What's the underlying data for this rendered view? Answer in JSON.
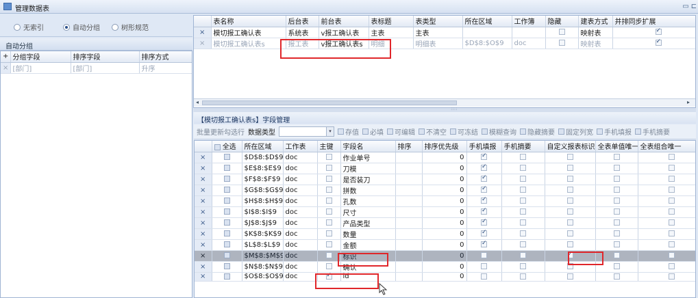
{
  "window": {
    "title": "管理数据表"
  },
  "index_options": [
    {
      "label": "无索引",
      "selected": false
    },
    {
      "label": "自动分组",
      "selected": true
    },
    {
      "label": "树形规范",
      "selected": false
    }
  ],
  "auto_group": {
    "title": "自动分组",
    "columns": [
      "分组字段",
      "排序字段",
      "排序方式"
    ],
    "rows": [
      {
        "group_field": "[部门]",
        "sort_field": "[部门]",
        "sort_order": "升序"
      }
    ]
  },
  "tables_grid": {
    "columns": [
      "表名称",
      "后台表",
      "前台表",
      "表标题",
      "表类型",
      "所在区域",
      "工作簿",
      "隐藏",
      "建表方式",
      "并排同步扩展"
    ],
    "rows": [
      {
        "name": "模切报工确认表",
        "backend": "系统表",
        "frontend": "v报工确认表",
        "title": "主表",
        "type": "主表",
        "region": "",
        "workbook": "",
        "hidden": false,
        "method": "映射表",
        "sync": true
      },
      {
        "name": "模切报工确认表s",
        "backend": "报工表",
        "frontend": "v报工确认表s",
        "title": "明细",
        "type": "明细表",
        "region": "$D$8:$O$9",
        "workbook": "doc",
        "hidden": false,
        "method": "映射表",
        "sync": true
      }
    ]
  },
  "field_section": {
    "title": "【模切报工确认表s】字段管理",
    "toolbar": {
      "batch_label": "批量更新勾选行",
      "datatype_label": "数据类型",
      "checks": [
        "存值",
        "必填",
        "可编辑",
        "不清空",
        "可冻结",
        "模糊查询",
        "隐藏摘要",
        "固定列宽",
        "手机填报",
        "手机摘要"
      ]
    },
    "columns": [
      "全选",
      "所在区域",
      "工作表",
      "主键",
      "字段名",
      "排序",
      "排序优先级",
      "手机填报",
      "手机摘要",
      "自定义报表标识",
      "全表单值唯一",
      "全表组合唯一"
    ],
    "rows": [
      {
        "region": "$D$8:$D$9",
        "sheet": "doc",
        "pk": false,
        "field": "作业单号",
        "priority": "0",
        "mobile": true,
        "custom": false
      },
      {
        "region": "$E$8:$E$9",
        "sheet": "doc",
        "pk": false,
        "field": "刀模",
        "priority": "0",
        "mobile": true,
        "custom": false
      },
      {
        "region": "$F$8:$F$9",
        "sheet": "doc",
        "pk": false,
        "field": "是否装刀",
        "priority": "0",
        "mobile": true,
        "custom": false
      },
      {
        "region": "$G$8:$G$9",
        "sheet": "doc",
        "pk": false,
        "field": "拼数",
        "priority": "0",
        "mobile": true,
        "custom": false
      },
      {
        "region": "$H$8:$H$9",
        "sheet": "doc",
        "pk": false,
        "field": "孔数",
        "priority": "0",
        "mobile": true,
        "custom": false
      },
      {
        "region": "$I$8:$I$9",
        "sheet": "doc",
        "pk": false,
        "field": "尺寸",
        "priority": "0",
        "mobile": true,
        "custom": false
      },
      {
        "region": "$J$8:$J$9",
        "sheet": "doc",
        "pk": false,
        "field": "产品类型",
        "priority": "0",
        "mobile": true,
        "custom": false
      },
      {
        "region": "$K$8:$K$9",
        "sheet": "doc",
        "pk": false,
        "field": "数量",
        "priority": "0",
        "mobile": true,
        "custom": false
      },
      {
        "region": "$L$8:$L$9",
        "sheet": "doc",
        "pk": false,
        "field": "金额",
        "priority": "0",
        "mobile": true,
        "custom": false
      },
      {
        "region": "$M$8:$M$9",
        "sheet": "doc",
        "pk": false,
        "field": "标识",
        "priority": "0",
        "mobile": false,
        "custom": true,
        "selected": true
      },
      {
        "region": "$N$8:$N$9",
        "sheet": "doc",
        "pk": false,
        "field": "确认",
        "priority": "0",
        "mobile": false,
        "custom": false
      },
      {
        "region": "$O$8:$O$9",
        "sheet": "doc",
        "pk": true,
        "field": "id",
        "priority": "0",
        "mobile": false,
        "custom": false
      }
    ]
  },
  "scroll_grip": "::::",
  "icons": {
    "row_delete": "×",
    "row_add": "+",
    "minimize": "▭",
    "dropdown": "▾",
    "scroll_left": "◂",
    "scroll_right": "▸"
  }
}
